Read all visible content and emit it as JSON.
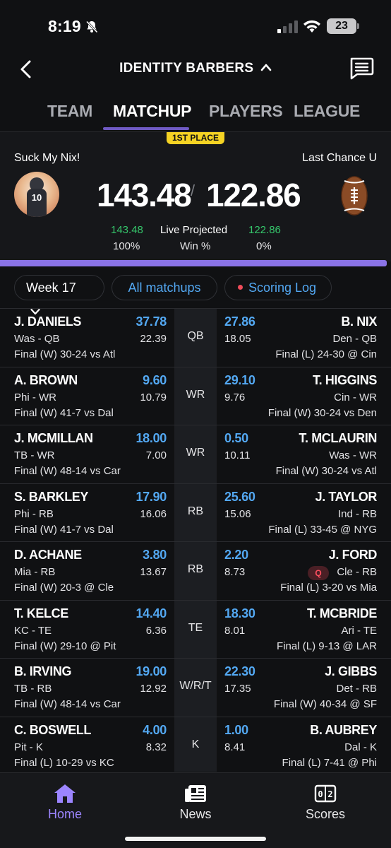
{
  "status_bar": {
    "time": "8:19",
    "battery": "23"
  },
  "header": {
    "league_name": "IDENTITY BARBERS"
  },
  "tabs": [
    {
      "label": "TEAM"
    },
    {
      "label": "MATCHUP"
    },
    {
      "label": "PLAYERS"
    },
    {
      "label": "LEAGUE"
    }
  ],
  "matchup": {
    "badge": "1ST PLACE",
    "left_team": {
      "name": "Suck My Nix!",
      "score": "143.48",
      "projected": "143.48",
      "win_pct": "100%",
      "avatar_number": "10"
    },
    "right_team": {
      "name": "Last Chance U",
      "score": "122.86",
      "projected": "122.86",
      "win_pct": "0%"
    },
    "proj_label": "Live Projected",
    "win_label": "Win %",
    "divider": "/"
  },
  "filters": {
    "week": "Week 17",
    "all_matchups": "All matchups",
    "scoring_log": "Scoring Log"
  },
  "roster": [
    {
      "slot": "QB",
      "left": {
        "name": "J. DANIELS",
        "points": "37.78",
        "info": "Was - QB",
        "proj": "22.39",
        "game": "Final (W) 30-24 vs Atl"
      },
      "right": {
        "name": "B. NIX",
        "points": "27.86",
        "info": "Den - QB",
        "proj": "18.05",
        "game": "Final (L) 24-30 @ Cin"
      }
    },
    {
      "slot": "WR",
      "left": {
        "name": "A. BROWN",
        "points": "9.60",
        "info": "Phi - WR",
        "proj": "10.79",
        "game": "Final (W) 41-7 vs Dal"
      },
      "right": {
        "name": "T. HIGGINS",
        "points": "29.10",
        "info": "Cin - WR",
        "proj": "9.76",
        "game": "Final (W) 30-24 vs Den"
      }
    },
    {
      "slot": "WR",
      "left": {
        "name": "J. MCMILLAN",
        "points": "18.00",
        "info": "TB - WR",
        "proj": "7.00",
        "game": "Final (W) 48-14 vs Car"
      },
      "right": {
        "name": "T. MCLAURIN",
        "points": "0.50",
        "info": "Was - WR",
        "proj": "10.11",
        "game": "Final (W) 30-24 vs Atl"
      }
    },
    {
      "slot": "RB",
      "left": {
        "name": "S. BARKLEY",
        "points": "17.90",
        "info": "Phi - RB",
        "proj": "16.06",
        "game": "Final (W) 41-7 vs Dal"
      },
      "right": {
        "name": "J. TAYLOR",
        "points": "25.60",
        "info": "Ind - RB",
        "proj": "15.06",
        "game": "Final (L) 33-45 @ NYG"
      }
    },
    {
      "slot": "RB",
      "left": {
        "name": "D. ACHANE",
        "points": "3.80",
        "info": "Mia - RB",
        "proj": "13.67",
        "game": "Final (W) 20-3 @ Cle"
      },
      "right": {
        "name": "J. FORD",
        "points": "2.20",
        "info": "Cle - RB",
        "proj": "8.73",
        "game": "Final (L) 3-20 vs Mia",
        "status": "Q"
      }
    },
    {
      "slot": "TE",
      "left": {
        "name": "T. KELCE",
        "points": "14.40",
        "info": "KC - TE",
        "proj": "6.36",
        "game": "Final (W) 29-10 @ Pit"
      },
      "right": {
        "name": "T. MCBRIDE",
        "points": "18.30",
        "info": "Ari - TE",
        "proj": "8.01",
        "game": "Final (L) 9-13 @ LAR"
      }
    },
    {
      "slot": "W/R/T",
      "left": {
        "name": "B. IRVING",
        "points": "19.00",
        "info": "TB - RB",
        "proj": "12.92",
        "game": "Final (W) 48-14 vs Car"
      },
      "right": {
        "name": "J. GIBBS",
        "points": "22.30",
        "info": "Det - RB",
        "proj": "17.35",
        "game": "Final (W) 40-34 @ SF"
      }
    },
    {
      "slot": "K",
      "left": {
        "name": "C. BOSWELL",
        "points": "4.00",
        "info": "Pit - K",
        "proj": "8.32",
        "game": "Final (L) 10-29 vs KC"
      },
      "right": {
        "name": "B. AUBREY",
        "points": "1.00",
        "info": "Dal - K",
        "proj": "8.41",
        "game": "Final (L) 7-41 @ Phi"
      }
    }
  ],
  "bottom_nav": [
    {
      "label": "Home",
      "icon": "home-icon"
    },
    {
      "label": "News",
      "icon": "news-icon"
    },
    {
      "label": "Scores",
      "icon": "scores-icon"
    }
  ],
  "colors": {
    "accent": "#8a73e6",
    "link": "#53a8f2",
    "positive": "#35c46a",
    "badge": "#f5d324"
  }
}
